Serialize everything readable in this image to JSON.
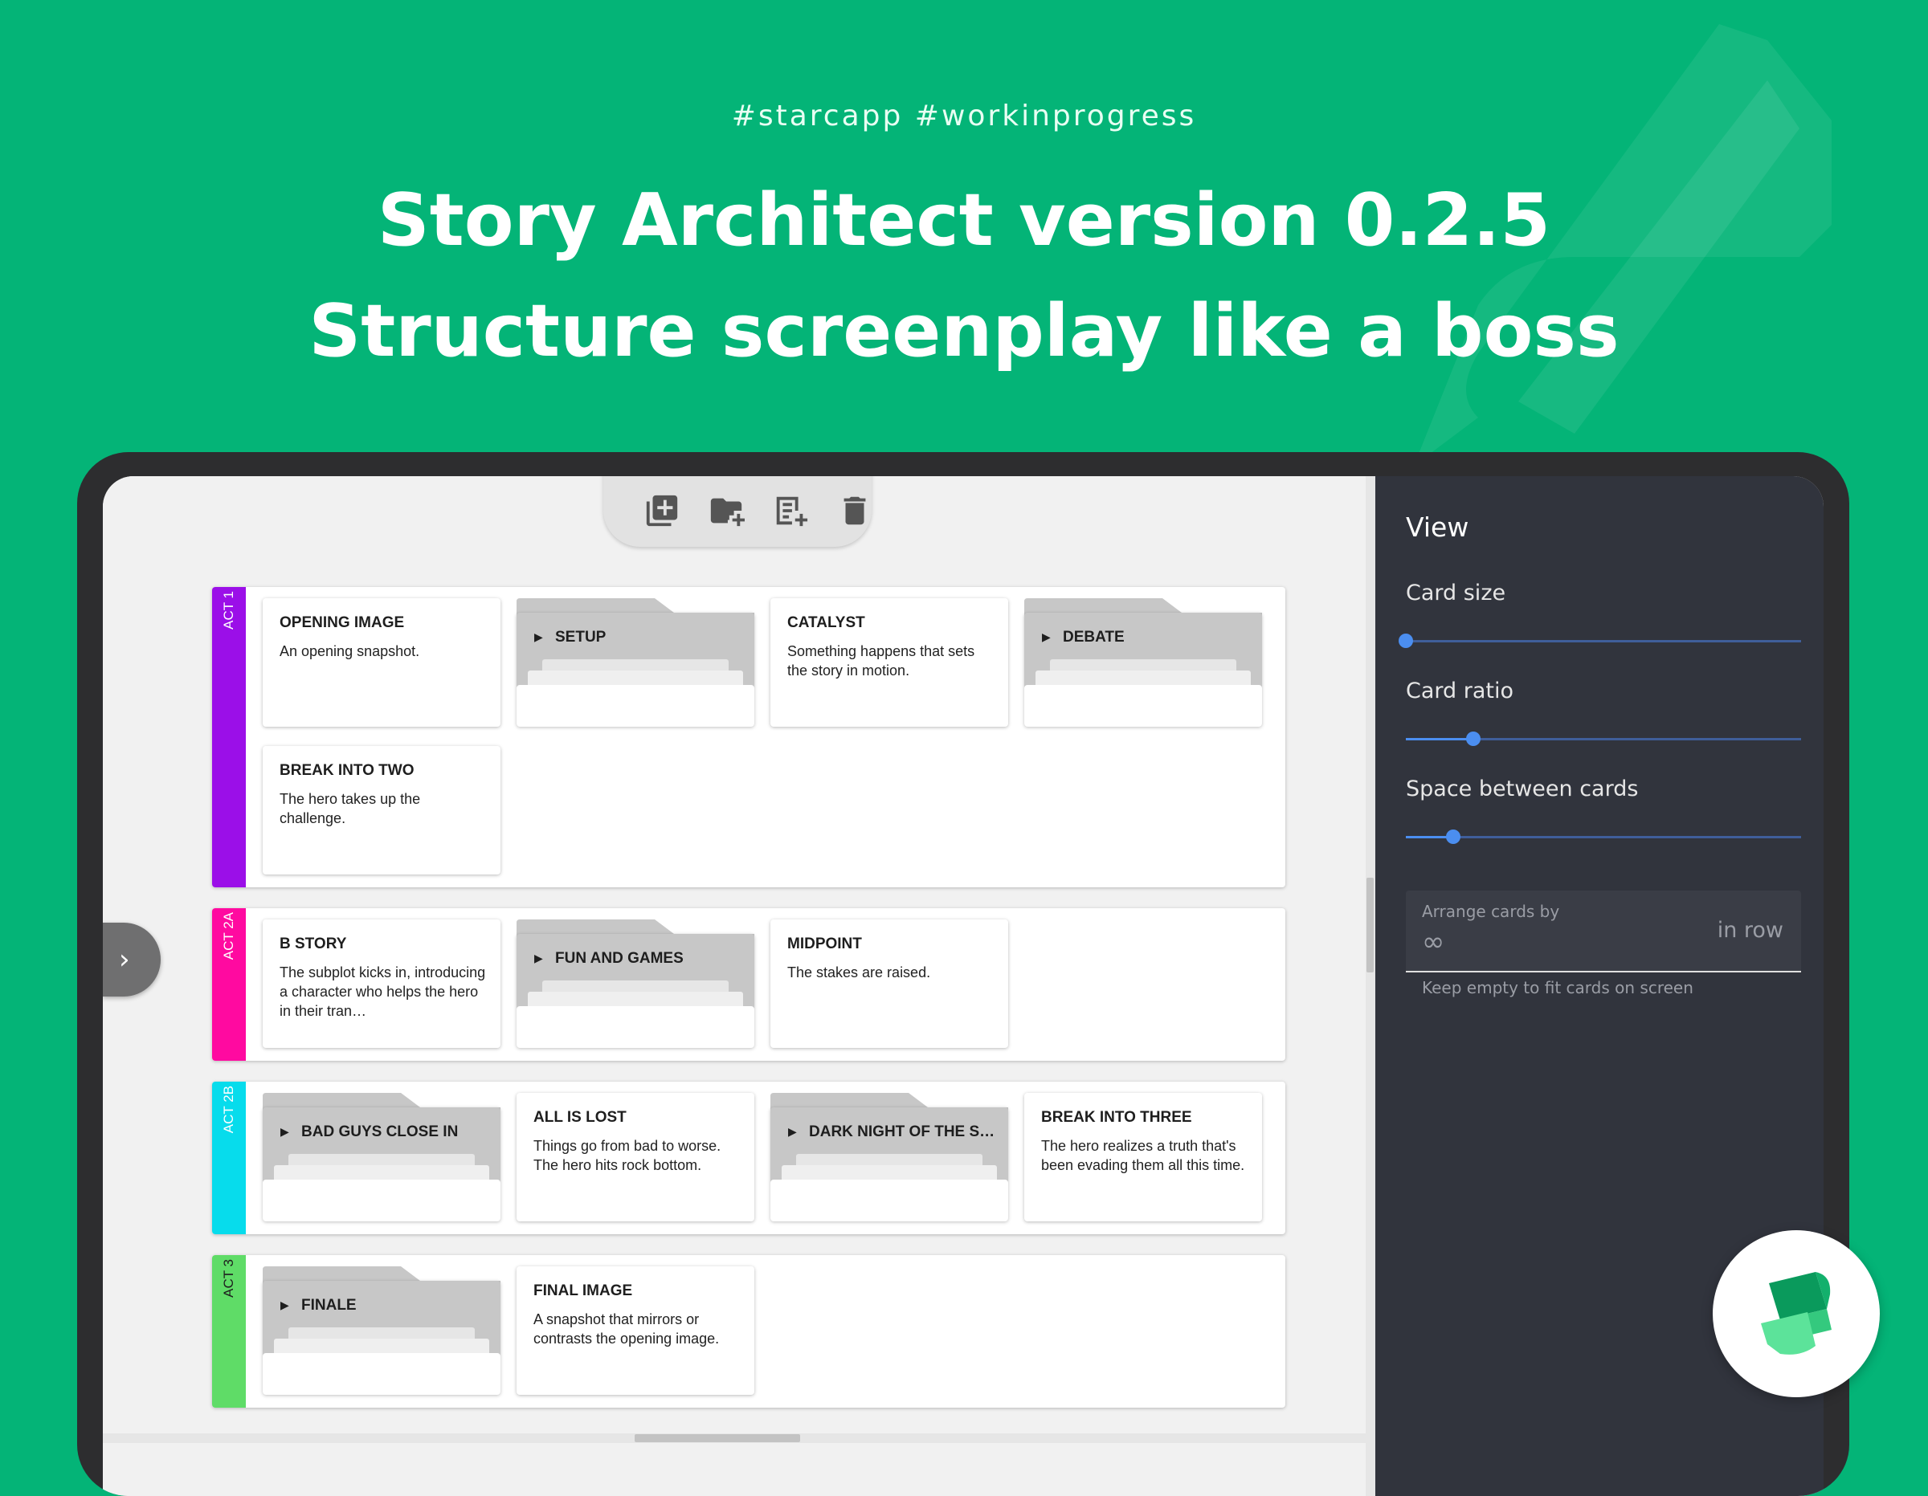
{
  "hero": {
    "tags": "#starcapp  #workinprogress",
    "title_line1": "Story Architect version 0.2.5",
    "title_line2": "Structure screenplay like a boss"
  },
  "toolbar": {
    "icons": [
      "add-card-icon",
      "add-folder-icon",
      "add-note-icon",
      "delete-icon"
    ]
  },
  "colors": {
    "background": "#04b477",
    "act1": "#9b0fe8",
    "act2a": "#ff0aa0",
    "act2b": "#07dcec",
    "act3": "#5fdc67",
    "panel": "#31343d",
    "slider": "#4b8ef0"
  },
  "acts": [
    {
      "label": "ACT 1",
      "items": [
        {
          "kind": "card",
          "title": "OPENING IMAGE",
          "desc": "An opening snapshot."
        },
        {
          "kind": "folder",
          "title": "SETUP"
        },
        {
          "kind": "card",
          "title": "CATALYST",
          "desc": "Something happens that sets the story in motion."
        },
        {
          "kind": "folder",
          "title": "DEBATE"
        },
        {
          "kind": "card",
          "title": "BREAK INTO TWO",
          "desc": "The hero takes up the challenge."
        }
      ]
    },
    {
      "label": "ACT 2A",
      "items": [
        {
          "kind": "card",
          "title": "B STORY",
          "desc": "The subplot kicks in, introducing a character who helps the hero in their tran…"
        },
        {
          "kind": "folder",
          "title": "FUN AND GAMES"
        },
        {
          "kind": "card",
          "title": "MIDPOINT",
          "desc": "The stakes are raised."
        }
      ]
    },
    {
      "label": "ACT 2B",
      "items": [
        {
          "kind": "folder",
          "title": "BAD GUYS CLOSE IN"
        },
        {
          "kind": "card",
          "title": "ALL IS LOST",
          "desc": "Things go from bad to worse. The hero hits rock bottom."
        },
        {
          "kind": "folder",
          "title": "DARK NIGHT OF THE S…"
        },
        {
          "kind": "card",
          "title": "BREAK INTO THREE",
          "desc": "The hero realizes a truth that's been evading them all this time."
        }
      ]
    },
    {
      "label": "ACT 3",
      "items": [
        {
          "kind": "folder",
          "title": "FINALE"
        },
        {
          "kind": "card",
          "title": "FINAL IMAGE",
          "desc": "A snapshot that mirrors or contrasts the opening image."
        }
      ]
    }
  ],
  "view_panel": {
    "title": "View",
    "card_size": {
      "label": "Card size",
      "value": 0.0
    },
    "card_ratio": {
      "label": "Card ratio",
      "value": 0.17
    },
    "space_between": {
      "label": "Space between cards",
      "value": 0.12
    },
    "arrange": {
      "label": "Arrange cards by",
      "value": "∞",
      "suffix": "in row",
      "helper": "Keep empty to fit cards on screen"
    }
  }
}
